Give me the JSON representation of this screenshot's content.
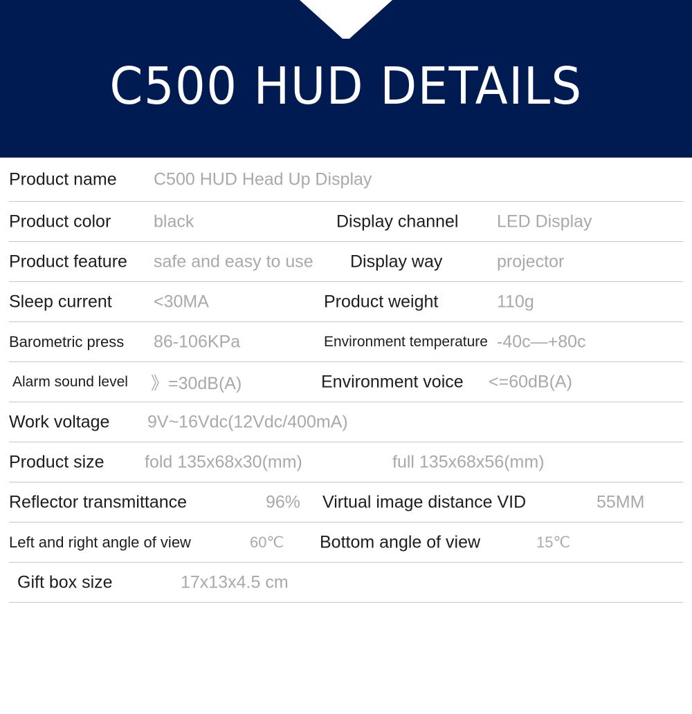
{
  "header": {
    "title": "C500 HUD DETAILS",
    "background_color": "#001a52",
    "title_color": "#ffffff",
    "notch_icon": "v-notch"
  },
  "styles": {
    "label_color": "#1d1d1d",
    "value_color": "#a9a9a9",
    "divider_color": "#c8c8c8"
  },
  "spec_table": {
    "rows": [
      {
        "label1": "Product name",
        "value1": "C500 HUD Head Up Display",
        "label2": "",
        "value2": ""
      },
      {
        "label1": "Product color",
        "value1": "black",
        "label2": "Display channel",
        "value2": "LED Display"
      },
      {
        "label1": "Product feature",
        "value1": "safe and easy to use",
        "label2": "Display way",
        "value2": "projector"
      },
      {
        "label1": "Sleep current",
        "value1": "<30MA",
        "label2": "Product weight",
        "value2": "110g"
      },
      {
        "label1": "Barometric press",
        "value1": "86-106KPa",
        "label2": "Environment temperature",
        "value2": "-40c—+80c"
      },
      {
        "label1": "Alarm sound level",
        "value1": "》=30dB(A)",
        "label2": "Environment voice",
        "value2": "<=60dB(A)"
      },
      {
        "label1": "Work voltage",
        "value1": "9V~16Vdc(12Vdc/400mA)",
        "label2": "",
        "value2": ""
      },
      {
        "label1": "Product size",
        "value1": "fold  135x68x30(mm)",
        "label2": "",
        "value2": "full 135x68x56(mm)"
      },
      {
        "label1": "Reflector transmittance",
        "value1": "96%",
        "label2": "Virtual image distance VID",
        "value2": "55MM"
      },
      {
        "label1": "Left and right angle of view",
        "value1": "60℃",
        "label2": "Bottom angle of view",
        "value2": "15℃"
      },
      {
        "label1": "Gift box size",
        "value1": "17x13x4.5 cm",
        "label2": "",
        "value2": ""
      }
    ]
  }
}
